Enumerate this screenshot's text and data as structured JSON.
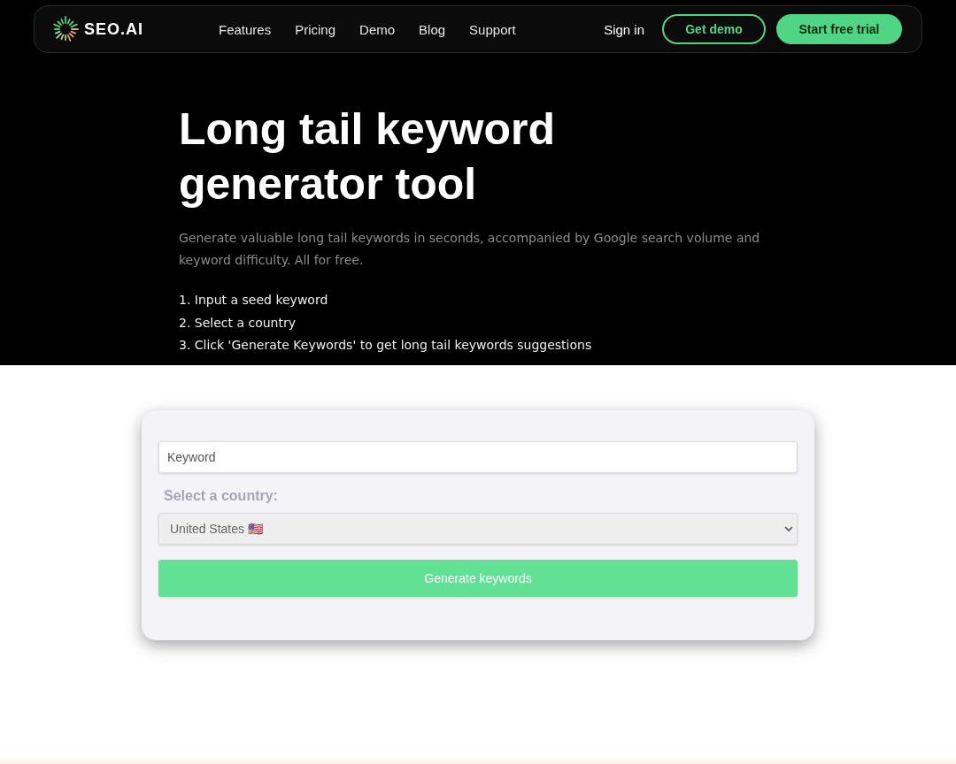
{
  "nav": {
    "logo": "SEO.AI",
    "links": [
      "Features",
      "Pricing",
      "Demo",
      "Blog",
      "Support"
    ],
    "sign_in": "Sign in",
    "demo_button": "Get demo",
    "trial_button": "Start free trial"
  },
  "hero": {
    "title": "Long tail keyword generator tool",
    "description": "Generate valuable long tail keywords in seconds, accompanied by Google search volume and keyword difficulty. All for free.",
    "steps": [
      "1. Input a seed keyword",
      "2. Select a country",
      "3. Click 'Generate Keywords' to get long tail keywords suggestions"
    ]
  },
  "form": {
    "keyword": {
      "placeholder": "Keyword"
    },
    "country_label": "Select a country:",
    "country": {
      "value": "United States 🇺🇸"
    },
    "submit": "Generate keywords"
  }
}
